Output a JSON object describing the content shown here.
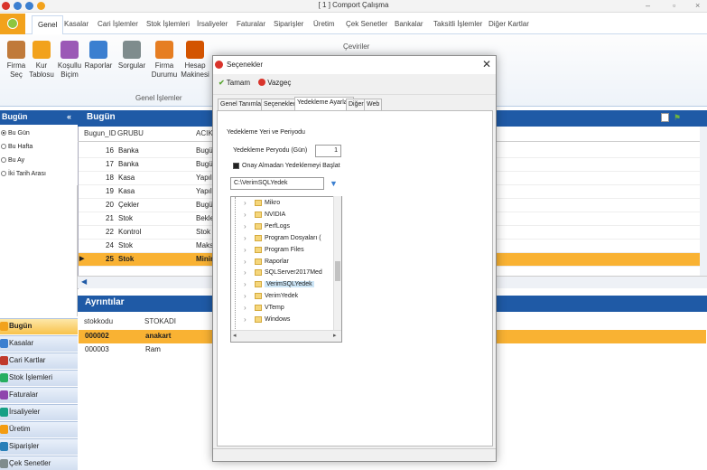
{
  "window": {
    "title": "[ 1 ] Comport Çalışma"
  },
  "menu_tabs": [
    "Genel",
    "Kasalar",
    "Cari İşlemler",
    "Stok İşlemleri",
    "İrsaliyeler",
    "Faturalar",
    "Siparişler",
    "Üretim",
    "Çek Senetler",
    "Bankalar",
    "Taksitli İşlemler",
    "Diğer Kartlar"
  ],
  "ribbon": {
    "buttons": [
      {
        "label": "Firma\nSeç",
        "icon": "building-icon"
      },
      {
        "label": "Kur\nTablosu",
        "icon": "currency-icon"
      },
      {
        "label": "Koşullu\nBiçim",
        "icon": "palette-icon"
      },
      {
        "label": "Raporlar",
        "icon": "report-icon"
      },
      {
        "label": "Sorgular",
        "icon": "query-icon"
      },
      {
        "label": "Firma\nDurumu",
        "icon": "chart-icon"
      },
      {
        "label": "Hesap\nMakinesi",
        "icon": "calculator-icon"
      }
    ],
    "group_label": "Genel İşlemler",
    "right_label": "Çeviriler"
  },
  "left_panel": {
    "title": "Bugün",
    "collapse": "«",
    "radios": [
      {
        "label": "Bu Gün",
        "checked": true
      },
      {
        "label": "Bu Hafta",
        "checked": false
      },
      {
        "label": "Bu Ay",
        "checked": false
      },
      {
        "label": "İki Tarih Arası",
        "checked": false
      }
    ],
    "nav": [
      "Bugün",
      "Kasalar",
      "Cari Kartlar",
      "Stok İşlemleri",
      "Faturalar",
      "İrsaliyeler",
      "Üretim",
      "Siparişler",
      "Çek Senetler"
    ],
    "nav_selected": 0
  },
  "main_panel": {
    "title": "Bugün",
    "columns": [
      "Bugun_ID",
      "GRUBU",
      "ACIKL"
    ],
    "rows": [
      {
        "id": "16",
        "group": "Banka",
        "desc": "Bugün"
      },
      {
        "id": "17",
        "group": "Banka",
        "desc": "Bugün"
      },
      {
        "id": "18",
        "group": "Kasa",
        "desc": "Yapıla"
      },
      {
        "id": "19",
        "group": "Kasa",
        "desc": "Yapıla"
      },
      {
        "id": "20",
        "group": "Çekler",
        "desc": "Bugün"
      },
      {
        "id": "21",
        "group": "Stok",
        "desc": "Bekley"
      },
      {
        "id": "22",
        "group": "Kontrol",
        "desc": "Stok K"
      },
      {
        "id": "24",
        "group": "Stok",
        "desc": "Maksir"
      },
      {
        "id": "25",
        "group": "Stok",
        "desc": "Minim"
      }
    ],
    "selected_row": 8
  },
  "details": {
    "title": "Ayrıntılar",
    "columns": [
      "stokkodu",
      "STOKADI"
    ],
    "rows": [
      {
        "code": "000002",
        "name": "anakart"
      },
      {
        "code": "000003",
        "name": "Ram"
      }
    ]
  },
  "dialog": {
    "title": "Seçenekler",
    "ok": "Tamam",
    "cancel": "Vazgeç",
    "tabs": [
      "Genel Tanımlar",
      "Seçenekler",
      "Yedekleme Ayarları",
      "Diğer",
      "Web"
    ],
    "active_tab": 2,
    "section_label": "Yedekleme Yeri ve Periyodu",
    "period_label": "Yedekleme Peryodu (Gün)",
    "period_value": "1",
    "confirm_label": "Onay Almadan Yedeklemeyi Başlat",
    "path_value": "C:\\VerimSQLYedek",
    "folders": [
      "Mikro",
      "NVIDIA",
      "PerfLogs",
      "Program Dosyaları (",
      "Program Files",
      "Raporlar",
      "SQLServer2017Med",
      "VerimSQLYedek",
      "VerimYedek",
      "VTemp",
      "Windows"
    ],
    "selected_folder": 7
  }
}
